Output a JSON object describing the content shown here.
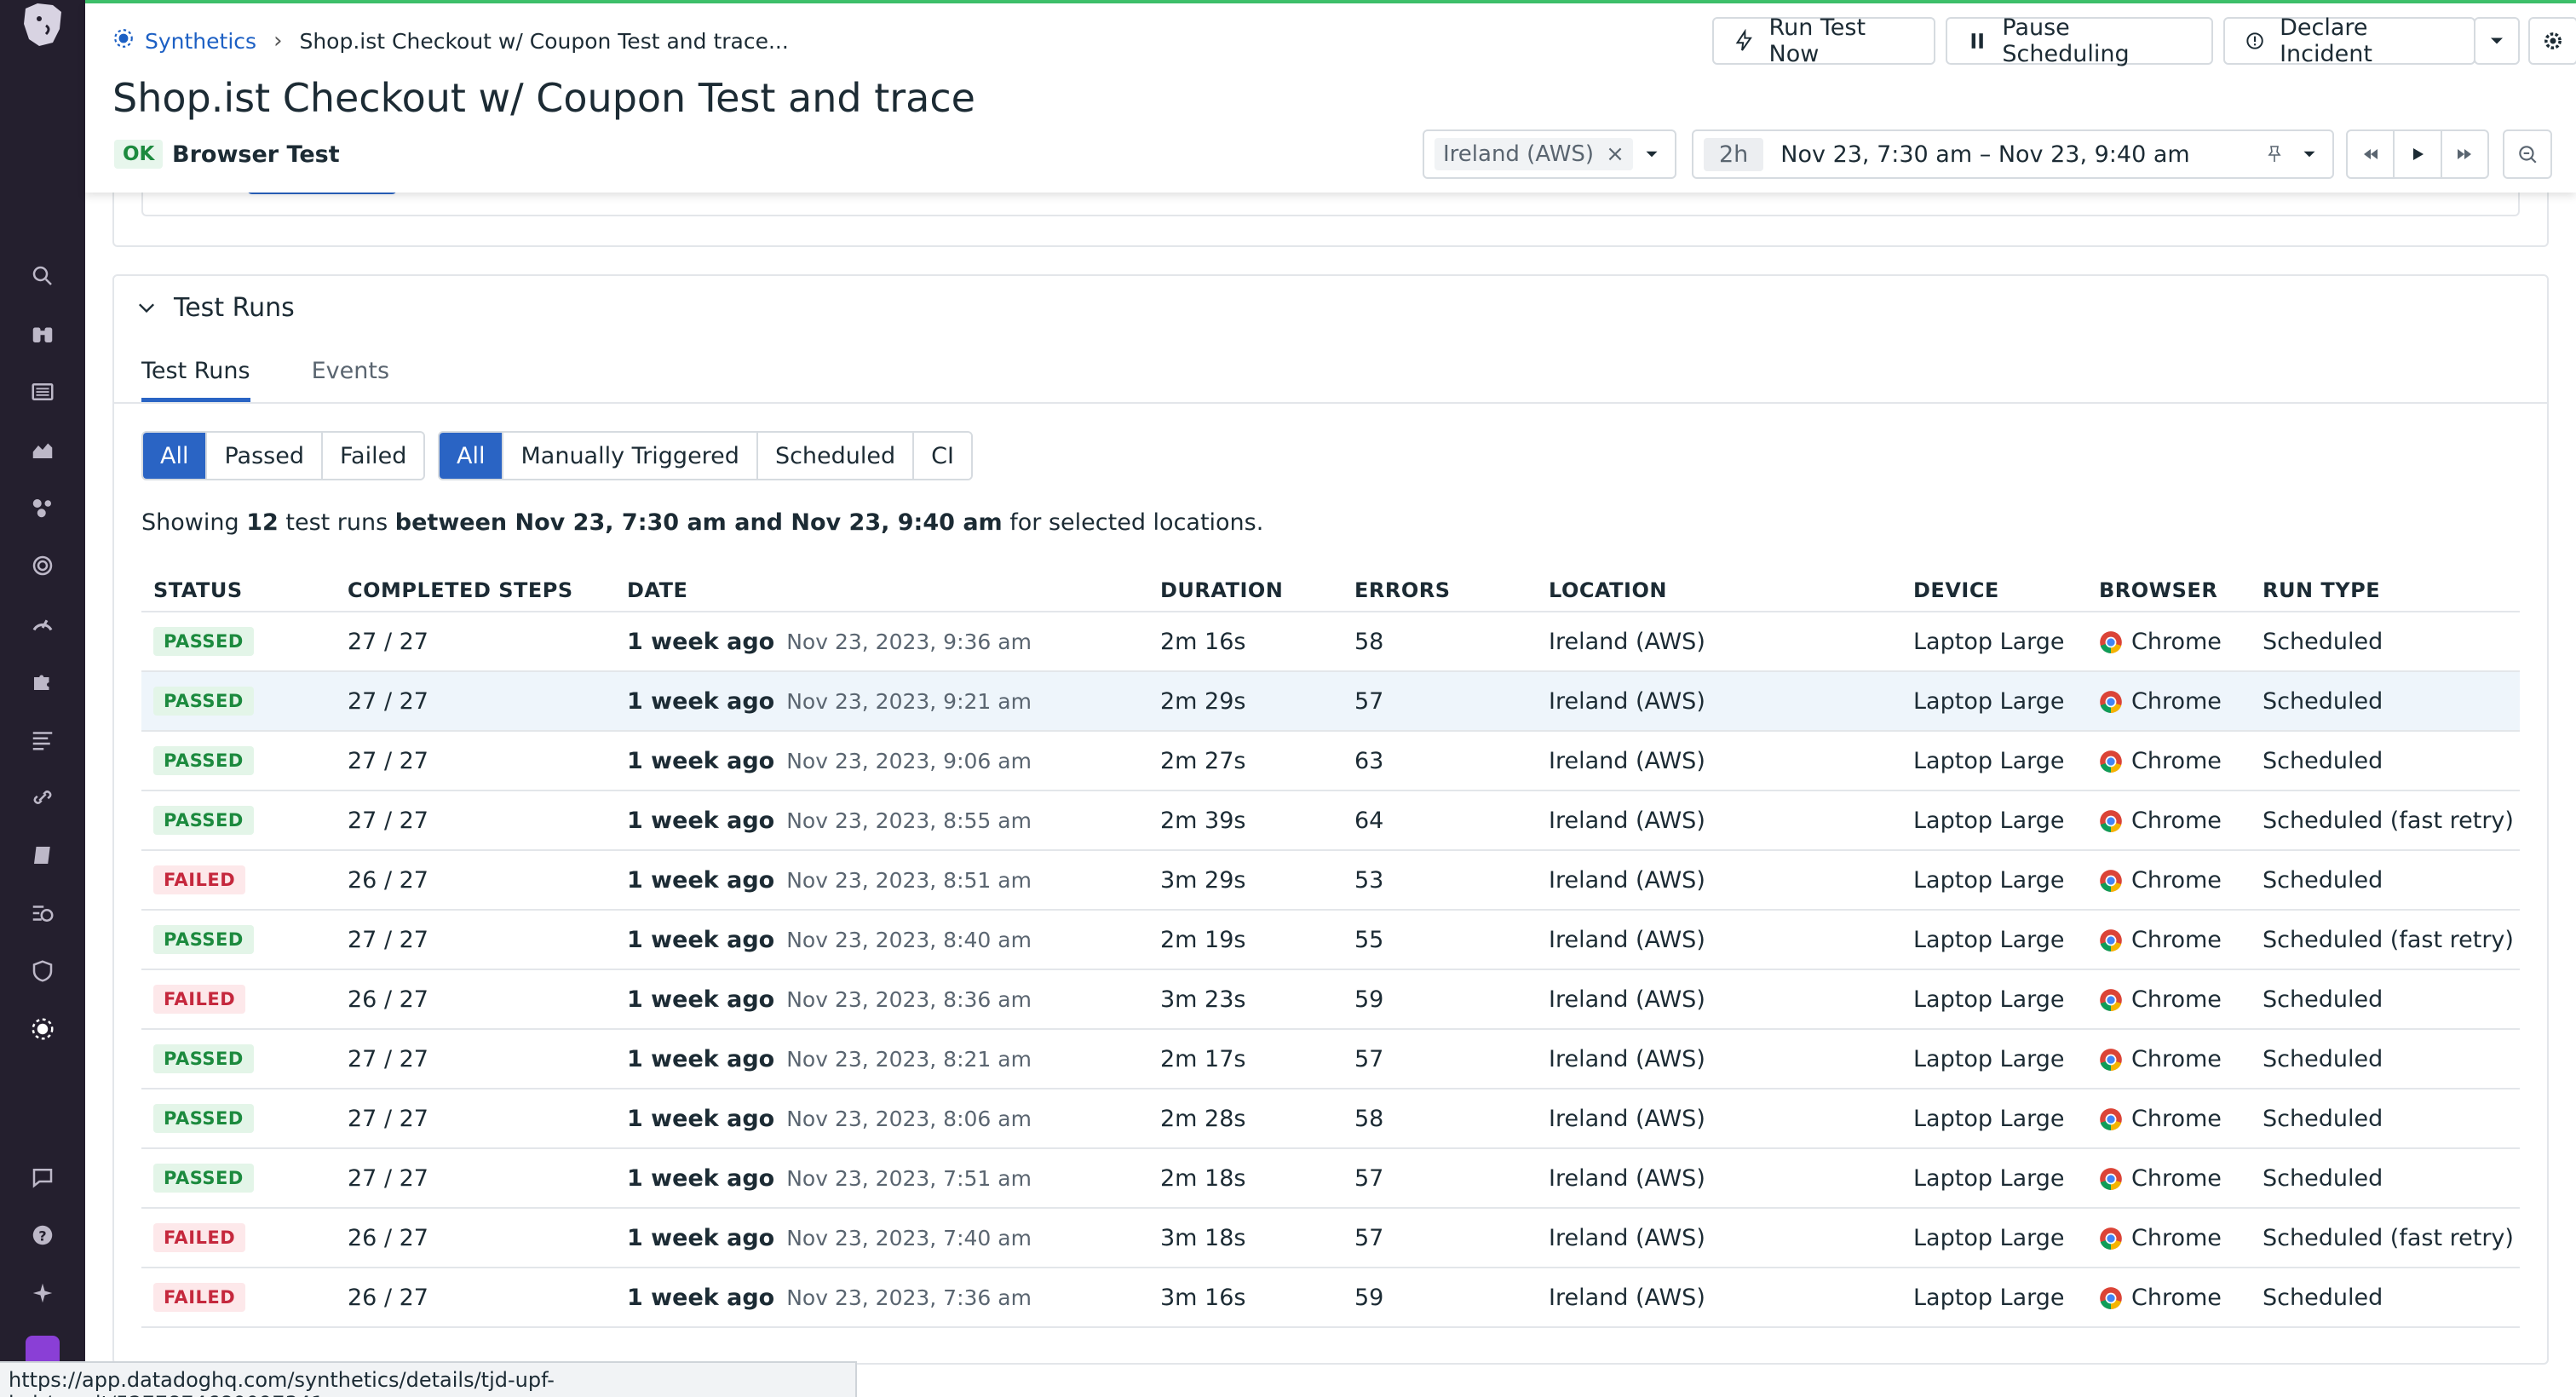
{
  "breadcrumb": {
    "root": "Synthetics",
    "current": "Shop.ist Checkout w/ Coupon Test and trace..."
  },
  "page": {
    "title": "Shop.ist Checkout w/ Coupon Test and trace",
    "status": "OK",
    "test_type": "Browser Test"
  },
  "actions": {
    "run_test": "Run Test Now",
    "pause": "Pause Scheduling",
    "incident": "Declare Incident"
  },
  "filters": {
    "location": "Ireland (AWS)",
    "time_chip": "2h",
    "time_range": "Nov 23, 7:30 am – Nov 23, 9:40 am"
  },
  "section": {
    "title": "Test Runs",
    "tabs": [
      "Test Runs",
      "Events"
    ]
  },
  "status_filter": [
    "All",
    "Passed",
    "Failed"
  ],
  "type_filter": [
    "All",
    "Manually Triggered",
    "Scheduled",
    "CI"
  ],
  "summary": {
    "prefix": "Showing",
    "count": "12",
    "mid": "test runs",
    "between": "between Nov 23, 7:30 am and Nov 23, 9:40 am",
    "suffix": "for selected locations."
  },
  "columns": [
    "STATUS",
    "COMPLETED STEPS",
    "DATE",
    "DURATION",
    "ERRORS",
    "LOCATION",
    "DEVICE",
    "BROWSER",
    "RUN TYPE"
  ],
  "rows": [
    {
      "status": "PASSED",
      "steps": "27 / 27",
      "ago": "1 week ago",
      "date": "Nov 23, 2023, 9:36 am",
      "duration": "2m 16s",
      "errors": "58",
      "location": "Ireland (AWS)",
      "device": "Laptop Large",
      "browser": "Chrome",
      "run_type": "Scheduled"
    },
    {
      "status": "PASSED",
      "steps": "27 / 27",
      "ago": "1 week ago",
      "date": "Nov 23, 2023, 9:21 am",
      "duration": "2m 29s",
      "errors": "57",
      "location": "Ireland (AWS)",
      "device": "Laptop Large",
      "browser": "Chrome",
      "run_type": "Scheduled"
    },
    {
      "status": "PASSED",
      "steps": "27 / 27",
      "ago": "1 week ago",
      "date": "Nov 23, 2023, 9:06 am",
      "duration": "2m 27s",
      "errors": "63",
      "location": "Ireland (AWS)",
      "device": "Laptop Large",
      "browser": "Chrome",
      "run_type": "Scheduled"
    },
    {
      "status": "PASSED",
      "steps": "27 / 27",
      "ago": "1 week ago",
      "date": "Nov 23, 2023, 8:55 am",
      "duration": "2m 39s",
      "errors": "64",
      "location": "Ireland (AWS)",
      "device": "Laptop Large",
      "browser": "Chrome",
      "run_type": "Scheduled (fast retry)"
    },
    {
      "status": "FAILED",
      "steps": "26 / 27",
      "ago": "1 week ago",
      "date": "Nov 23, 2023, 8:51 am",
      "duration": "3m 29s",
      "errors": "53",
      "location": "Ireland (AWS)",
      "device": "Laptop Large",
      "browser": "Chrome",
      "run_type": "Scheduled"
    },
    {
      "status": "PASSED",
      "steps": "27 / 27",
      "ago": "1 week ago",
      "date": "Nov 23, 2023, 8:40 am",
      "duration": "2m 19s",
      "errors": "55",
      "location": "Ireland (AWS)",
      "device": "Laptop Large",
      "browser": "Chrome",
      "run_type": "Scheduled (fast retry)"
    },
    {
      "status": "FAILED",
      "steps": "26 / 27",
      "ago": "1 week ago",
      "date": "Nov 23, 2023, 8:36 am",
      "duration": "3m 23s",
      "errors": "59",
      "location": "Ireland (AWS)",
      "device": "Laptop Large",
      "browser": "Chrome",
      "run_type": "Scheduled"
    },
    {
      "status": "PASSED",
      "steps": "27 / 27",
      "ago": "1 week ago",
      "date": "Nov 23, 2023, 8:21 am",
      "duration": "2m 17s",
      "errors": "57",
      "location": "Ireland (AWS)",
      "device": "Laptop Large",
      "browser": "Chrome",
      "run_type": "Scheduled"
    },
    {
      "status": "PASSED",
      "steps": "27 / 27",
      "ago": "1 week ago",
      "date": "Nov 23, 2023, 8:06 am",
      "duration": "2m 28s",
      "errors": "58",
      "location": "Ireland (AWS)",
      "device": "Laptop Large",
      "browser": "Chrome",
      "run_type": "Scheduled"
    },
    {
      "status": "PASSED",
      "steps": "27 / 27",
      "ago": "1 week ago",
      "date": "Nov 23, 2023, 7:51 am",
      "duration": "2m 18s",
      "errors": "57",
      "location": "Ireland (AWS)",
      "device": "Laptop Large",
      "browser": "Chrome",
      "run_type": "Scheduled"
    },
    {
      "status": "FAILED",
      "steps": "26 / 27",
      "ago": "1 week ago",
      "date": "Nov 23, 2023, 7:40 am",
      "duration": "3m 18s",
      "errors": "57",
      "location": "Ireland (AWS)",
      "device": "Laptop Large",
      "browser": "Chrome",
      "run_type": "Scheduled (fast retry)"
    },
    {
      "status": "FAILED",
      "steps": "26 / 27",
      "ago": "1 week ago",
      "date": "Nov 23, 2023, 7:36 am",
      "duration": "3m 16s",
      "errors": "59",
      "location": "Ireland (AWS)",
      "device": "Laptop Large",
      "browser": "Chrome",
      "run_type": "Scheduled"
    }
  ],
  "status_bar": {
    "url": "https://app.datadoghq.com/synthetics/details/tjd-upf-kvk/result/5277874680097341..."
  },
  "colors": {
    "accent": "#2a64c4",
    "link": "#1d60c4",
    "passed": "#1c8a3e",
    "failed": "#c5283d",
    "sidebar": "#241f2e",
    "topline": "#3ec26b"
  },
  "sidebar_icons": [
    "search-icon",
    "binoculars-icon",
    "logs-icon",
    "metrics-icon",
    "integrations-icon",
    "apm-icon",
    "dashboard-icon",
    "puzzle-icon",
    "list-icon",
    "link-icon",
    "notebook-icon",
    "monitor-icon",
    "security-icon",
    "synthetics-icon",
    "chat-icon",
    "help-icon",
    "sparkle-icon"
  ]
}
